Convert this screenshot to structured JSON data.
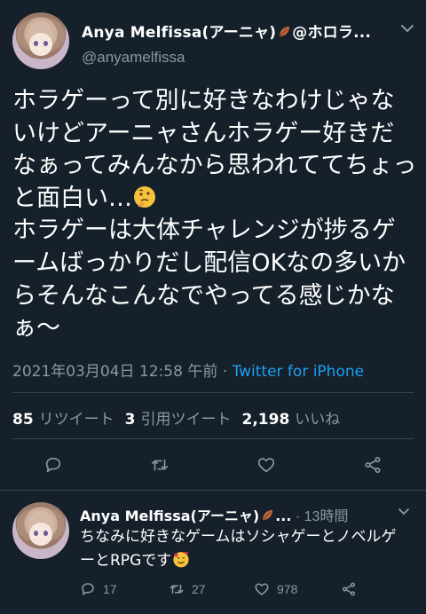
{
  "colors": {
    "background": "#15202b",
    "text": "#ffffff",
    "muted": "#8899a6",
    "link": "#1da1f2",
    "divider": "#38444d"
  },
  "tweet": {
    "display_name": "Anya Melfissa(アーニャ)",
    "name_suffix": "@ホロラ...",
    "handle": "@anyamelfissa",
    "text_part1": "ホラゲーって別に好きなわけじゃないけどアーニャさんホラゲー好きだなぁってみんなから思われててちょっと面白い…",
    "emoji1": "thinking-face",
    "text_part2": "ホラゲーは大体チャレンジが捗るゲームばっかりだし配信OKなの多いからそんなこんなでやってる感じかなぁ～",
    "timestamp": "2021年03月04日 12:58 午前",
    "separator": " · ",
    "app": "Twitter for iPhone",
    "retweets_count": "85",
    "retweets_label": "リツイート",
    "quotes_count": "3",
    "quotes_label": "引用ツイート",
    "likes_count": "2,198",
    "likes_label": "いいね",
    "icons": [
      "reply-icon",
      "retweet-icon",
      "like-icon",
      "share-icon",
      "more-icon",
      "leaf-icon"
    ]
  },
  "reply": {
    "display_name": "Anya Melfissa(アーニャ)",
    "name_ellipsis": "...",
    "time": " · 13時間",
    "text": "ちなみに好きなゲームはソシャゲーとノベルゲーとRPGです",
    "emoji": "smiling-face-with-hearts",
    "reply_count": "17",
    "retweet_count": "27",
    "like_count": "978"
  }
}
